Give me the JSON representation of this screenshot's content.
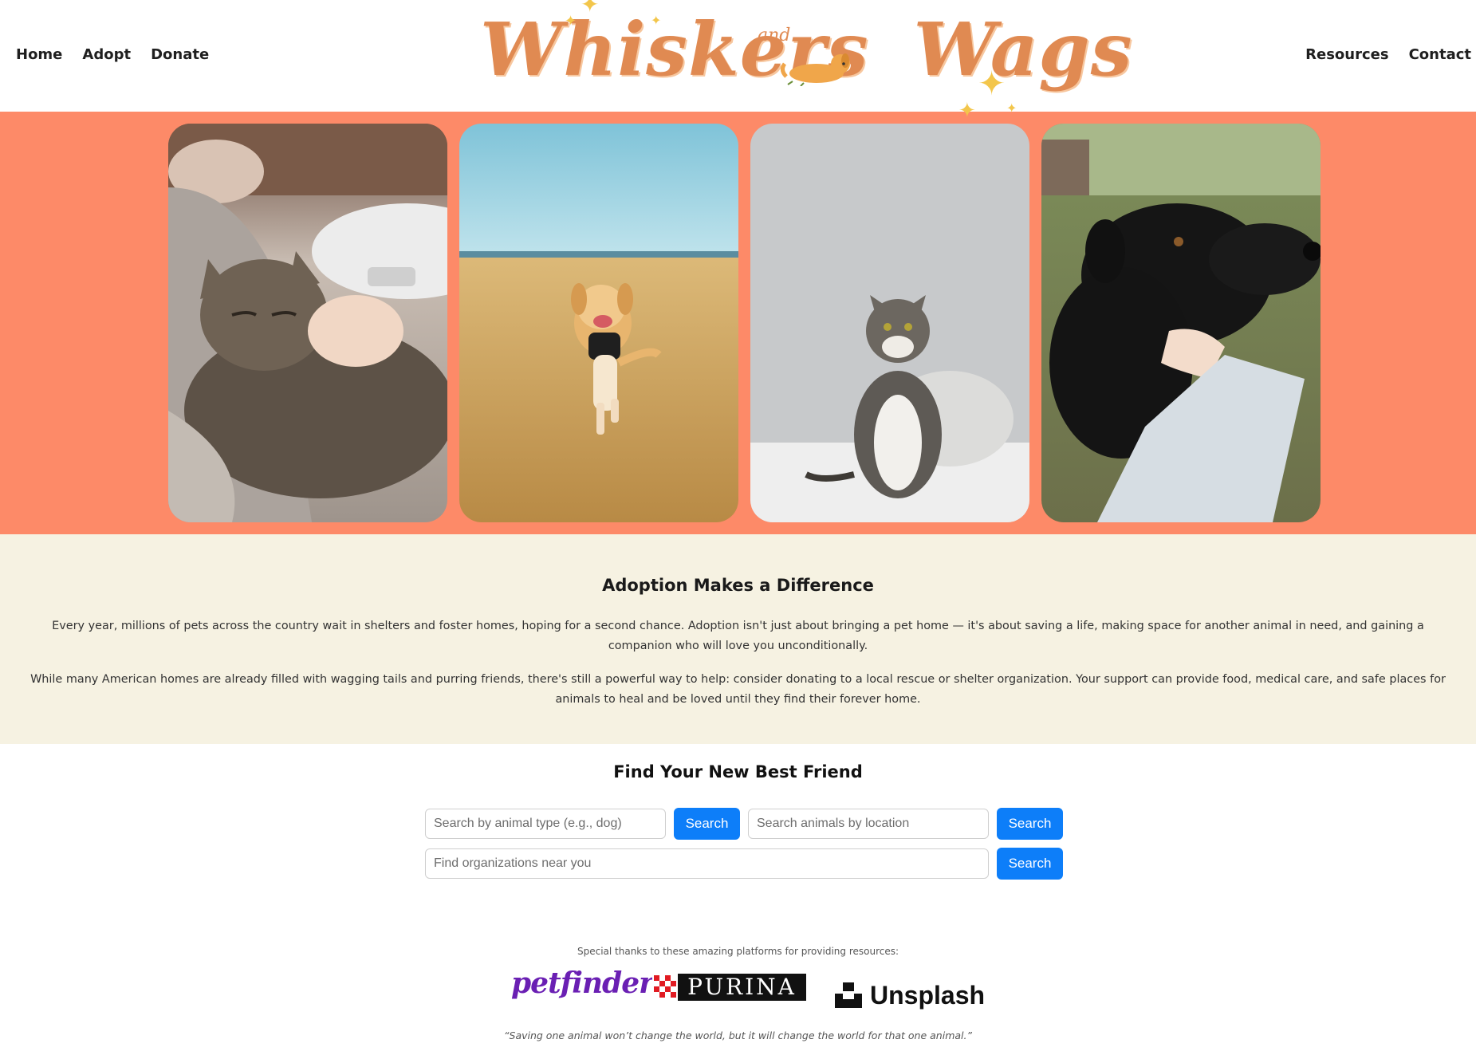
{
  "nav": {
    "left": [
      "Home",
      "Adopt",
      "Donate"
    ],
    "right": [
      "Resources",
      "Contact"
    ]
  },
  "logo": {
    "text": "Whiskers",
    "and": "and",
    "text2": "Wags"
  },
  "hero": {
    "photos": [
      {
        "alt": "tabby cat sleeping in owner's arms"
      },
      {
        "alt": "golden retriever running on the beach"
      },
      {
        "alt": "tabby and white cat sitting on a bed"
      },
      {
        "alt": "black dog being petted under the chin"
      }
    ]
  },
  "about": {
    "title": "Adoption Makes a Difference",
    "p1": "Every year, millions of pets across the country wait in shelters and foster homes, hoping for a second chance. Adoption isn't just about bringing a pet home — it's about saving a life, making space for another animal in need, and gaining a companion who will love you unconditionally.",
    "p2": "While many American homes are already filled with wagging tails and purring friends, there's still a powerful way to help: consider donating to a local rescue or shelter organization. Your support can provide food, medical care, and safe places for animals to heal and be loved until they find their forever home."
  },
  "search": {
    "title": "Find Your New Best Friend",
    "animal_type_placeholder": "Search by animal type (e.g., dog)",
    "location_placeholder": "Search animals by location",
    "organizations_placeholder": "Find organizations near you",
    "button_label": "Search"
  },
  "credits": {
    "thanks": "Special thanks to these amazing platforms for providing resources:",
    "partners": [
      "petfinder",
      "PURINA",
      "Unsplash"
    ],
    "quote": "“Saving one animal won’t change the world, but it will change the world for that one animal.”"
  },
  "colors": {
    "hero_bg": "#fd8a68",
    "about_bg": "#f6f2e2",
    "button": "#0d7ef9",
    "logo": "#e08a52"
  }
}
